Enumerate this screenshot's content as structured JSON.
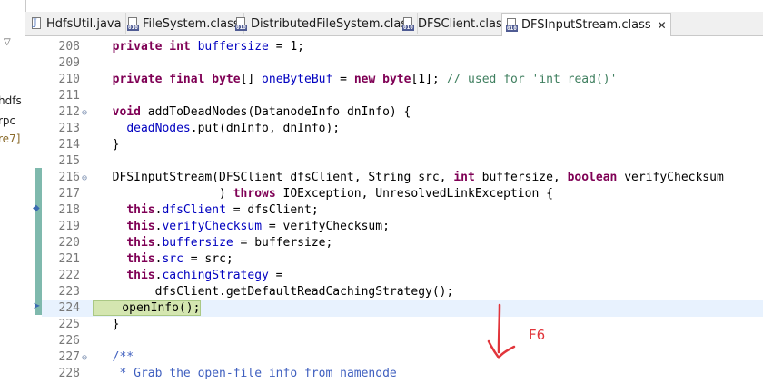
{
  "left_panel": {
    "fragments": [
      "hdfs",
      "rpc",
      "re7]"
    ]
  },
  "tabs": [
    {
      "label": "HdfsUtil.java",
      "icon": "java-file-icon",
      "active": false
    },
    {
      "label": "FileSystem.class",
      "icon": "class-file-icon",
      "active": false
    },
    {
      "label": "DistributedFileSystem.class",
      "icon": "class-file-icon",
      "active": false
    },
    {
      "label": "DFSClient.class",
      "icon": "class-file-icon",
      "active": false
    },
    {
      "label": "DFSInputStream.class",
      "icon": "class-file-icon",
      "active": true,
      "close": "✕"
    }
  ],
  "code_lines": [
    {
      "num": "208",
      "fold": "",
      "segments": [
        {
          "t": "  "
        },
        {
          "t": "private",
          "c": "kw"
        },
        {
          "t": " "
        },
        {
          "t": "int",
          "c": "kw"
        },
        {
          "t": " "
        },
        {
          "t": "buffersize",
          "c": "fld"
        },
        {
          "t": " = 1;"
        }
      ]
    },
    {
      "num": "209",
      "fold": "",
      "segments": []
    },
    {
      "num": "210",
      "fold": "",
      "segments": [
        {
          "t": "  "
        },
        {
          "t": "private",
          "c": "kw"
        },
        {
          "t": " "
        },
        {
          "t": "final",
          "c": "kw"
        },
        {
          "t": " "
        },
        {
          "t": "byte",
          "c": "kw"
        },
        {
          "t": "[] "
        },
        {
          "t": "oneByteBuf",
          "c": "fld"
        },
        {
          "t": " = "
        },
        {
          "t": "new",
          "c": "kw"
        },
        {
          "t": " "
        },
        {
          "t": "byte",
          "c": "kw"
        },
        {
          "t": "[1]; "
        },
        {
          "t": "// used for 'int read()'",
          "c": "cmt"
        }
      ]
    },
    {
      "num": "211",
      "fold": "",
      "segments": []
    },
    {
      "num": "212",
      "fold": "⊖",
      "segments": [
        {
          "t": "  "
        },
        {
          "t": "void",
          "c": "kw"
        },
        {
          "t": " addToDeadNodes(DatanodeInfo dnInfo) {"
        }
      ]
    },
    {
      "num": "213",
      "fold": "",
      "segments": [
        {
          "t": "    "
        },
        {
          "t": "deadNodes",
          "c": "fld"
        },
        {
          "t": ".put(dnInfo, dnInfo);"
        }
      ]
    },
    {
      "num": "214",
      "fold": "",
      "segments": [
        {
          "t": "  }"
        }
      ]
    },
    {
      "num": "215",
      "fold": "",
      "segments": []
    },
    {
      "num": "216",
      "fold": "⊖",
      "segments": [
        {
          "t": "  DFSInputStream(DFSClient dfsClient, String src, "
        },
        {
          "t": "int",
          "c": "kw"
        },
        {
          "t": " buffersize, "
        },
        {
          "t": "boolean",
          "c": "kw"
        },
        {
          "t": " verifyChecksum"
        }
      ]
    },
    {
      "num": "217",
      "fold": "",
      "segments": [
        {
          "t": "                 ) "
        },
        {
          "t": "throws",
          "c": "kw"
        },
        {
          "t": " IOException, UnresolvedLinkException {"
        }
      ]
    },
    {
      "num": "218",
      "fold": "",
      "segments": [
        {
          "t": "    "
        },
        {
          "t": "this",
          "c": "kw"
        },
        {
          "t": "."
        },
        {
          "t": "dfsClient",
          "c": "fld"
        },
        {
          "t": " = dfsClient;"
        }
      ]
    },
    {
      "num": "219",
      "fold": "",
      "segments": [
        {
          "t": "    "
        },
        {
          "t": "this",
          "c": "kw"
        },
        {
          "t": "."
        },
        {
          "t": "verifyChecksum",
          "c": "fld"
        },
        {
          "t": " = verifyChecksum;"
        }
      ]
    },
    {
      "num": "220",
      "fold": "",
      "segments": [
        {
          "t": "    "
        },
        {
          "t": "this",
          "c": "kw"
        },
        {
          "t": "."
        },
        {
          "t": "buffersize",
          "c": "fld"
        },
        {
          "t": " = buffersize;"
        }
      ]
    },
    {
      "num": "221",
      "fold": "",
      "segments": [
        {
          "t": "    "
        },
        {
          "t": "this",
          "c": "kw"
        },
        {
          "t": "."
        },
        {
          "t": "src",
          "c": "fld"
        },
        {
          "t": " = src;"
        }
      ]
    },
    {
      "num": "222",
      "fold": "",
      "segments": [
        {
          "t": "    "
        },
        {
          "t": "this",
          "c": "kw"
        },
        {
          "t": "."
        },
        {
          "t": "cachingStrategy",
          "c": "fld"
        },
        {
          "t": " ="
        }
      ]
    },
    {
      "num": "223",
      "fold": "",
      "segments": [
        {
          "t": "        dfsClient.getDefaultReadCachingStrategy();"
        }
      ]
    },
    {
      "num": "224",
      "fold": "",
      "current": true,
      "segments": [
        {
          "t": "    openInfo();"
        }
      ]
    },
    {
      "num": "225",
      "fold": "",
      "segments": [
        {
          "t": "  }"
        }
      ]
    },
    {
      "num": "226",
      "fold": "",
      "segments": []
    },
    {
      "num": "227",
      "fold": "⊖",
      "segments": [
        {
          "t": "  "
        },
        {
          "t": "/**",
          "c": "jd"
        }
      ]
    },
    {
      "num": "228",
      "fold": "",
      "segments": [
        {
          "t": "   "
        },
        {
          "t": "* Grab the open-file info from namenode",
          "c": "jd"
        }
      ]
    }
  ],
  "annotation": {
    "label": "F6",
    "color": "#e1353b"
  },
  "colors": {
    "keyword": "#7f0055",
    "field": "#0000c0",
    "comment": "#3f7f5f",
    "javadoc": "#3f5fbf",
    "current_line": "#d4e6b0"
  }
}
